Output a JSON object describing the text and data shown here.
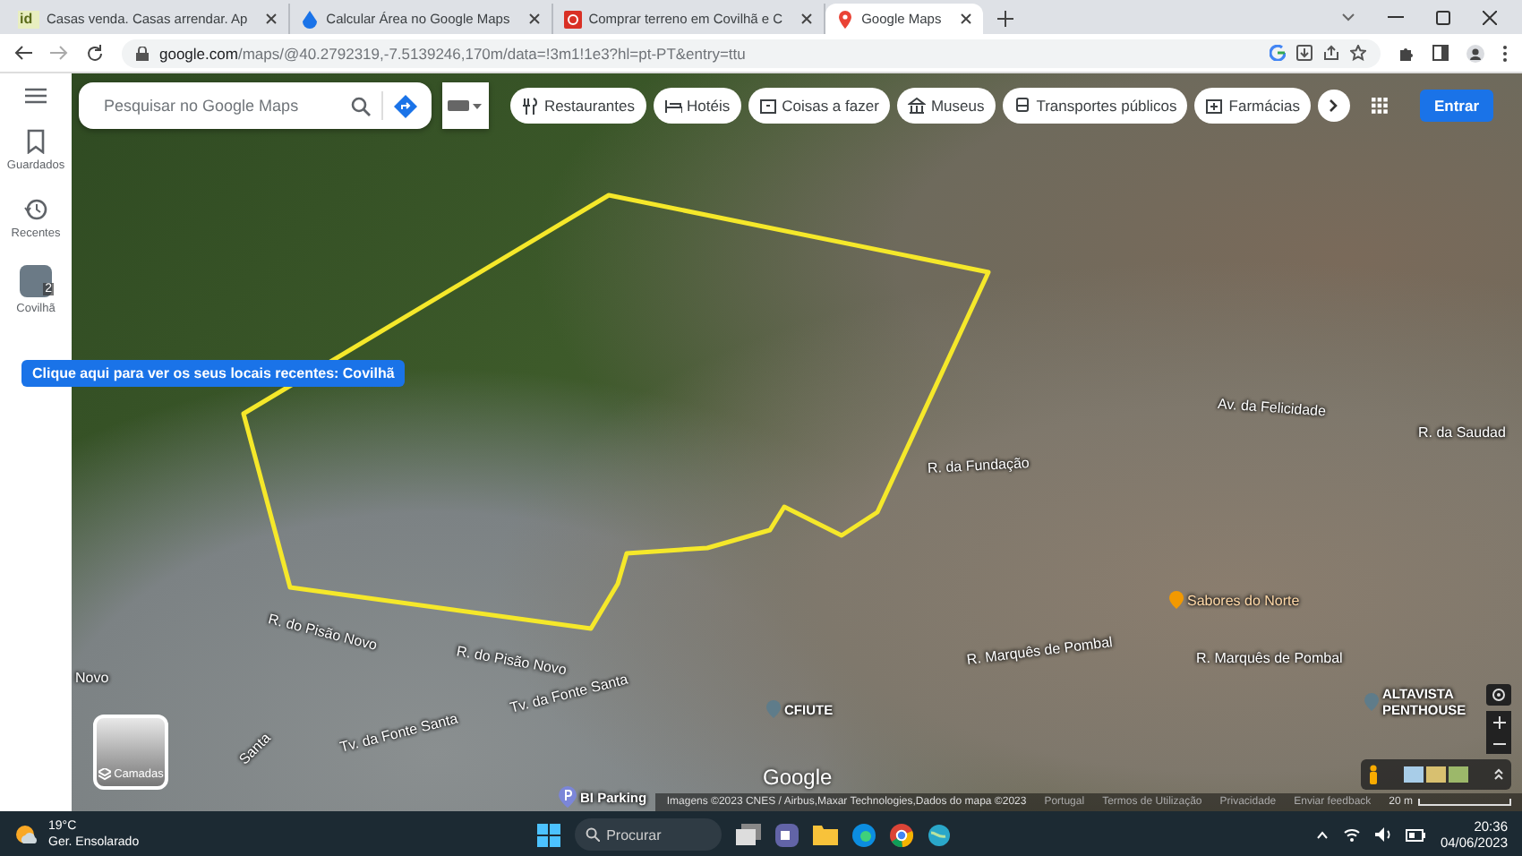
{
  "browser": {
    "tabs": [
      {
        "kind": "text",
        "favicon_text": "id",
        "title": "Casas venda. Casas arrendar. Ap",
        "selected": false
      },
      {
        "kind": "calc",
        "title": "Calcular Área no Google Maps",
        "selected": false
      },
      {
        "kind": "red",
        "title": "Comprar terreno em Covilhã e C",
        "selected": false
      },
      {
        "kind": "maps",
        "title": "Google Maps",
        "selected": true
      }
    ],
    "url_host": "google.com",
    "url_path": "/maps/@40.2792319,-7.5139246,170m/data=!3m1!1e3?hl=pt-PT&entry=ttu"
  },
  "sidebar": {
    "items": [
      {
        "kind": "saved",
        "label": "Guardados"
      },
      {
        "kind": "recent",
        "label": "Recentes"
      },
      {
        "kind": "place",
        "label": "Covilhã",
        "badge": "2"
      }
    ],
    "tooltip": "Clique aqui para ver os seus locais recentes: Covilhã"
  },
  "search": {
    "placeholder": "Pesquisar no Google Maps"
  },
  "chips": [
    {
      "kind": "food",
      "label": "Restaurantes"
    },
    {
      "kind": "hotel",
      "label": "Hotéis"
    },
    {
      "kind": "todo",
      "label": "Coisas a fazer"
    },
    {
      "kind": "museum",
      "label": "Museus"
    },
    {
      "kind": "transit",
      "label": "Transportes públicos"
    },
    {
      "kind": "pharmacy",
      "label": "Farmácias"
    }
  ],
  "sign_in": "Entrar",
  "map": {
    "labels": [
      {
        "kind": "street",
        "text": "R. do Pisão Novo"
      },
      {
        "kind": "street",
        "text": "R. do Pisão Novo"
      },
      {
        "kind": "street",
        "text": "Novo"
      },
      {
        "kind": "street",
        "text": "Tv. da Fonte Santa"
      },
      {
        "kind": "street",
        "text": "Tv. da Fonte Santa"
      },
      {
        "kind": "street",
        "text": "Santa"
      },
      {
        "kind": "street",
        "text": "R. Marquês de Pombal"
      },
      {
        "kind": "street",
        "text": "R. Marquês de Pombal"
      },
      {
        "kind": "street",
        "text": "Av. da Felicidade"
      },
      {
        "kind": "street",
        "text": "R. da Fundação"
      },
      {
        "kind": "street",
        "text": "R. da Saudad"
      },
      {
        "kind": "food",
        "text": "Sabores do Norte"
      },
      {
        "kind": "place",
        "text": "CFIUTE"
      },
      {
        "kind": "place",
        "text": "ALTAVISTA PENTHOUSE"
      },
      {
        "kind": "parking",
        "text": "BI Parking"
      }
    ],
    "logo": "Google",
    "layers_label": "Camadas",
    "attribution": [
      "Imagens ©2023 CNES / Airbus,Maxar Technologies,Dados do mapa ©2023",
      "Portugal",
      "Termos de Utilização",
      "Privacidade",
      "Enviar feedback"
    ],
    "scale": "20 m"
  },
  "taskbar": {
    "temperature": "19°C",
    "weather": "Ger. Ensolarado",
    "search_placeholder": "Procurar",
    "time": "20:36",
    "date": "04/06/2023"
  }
}
